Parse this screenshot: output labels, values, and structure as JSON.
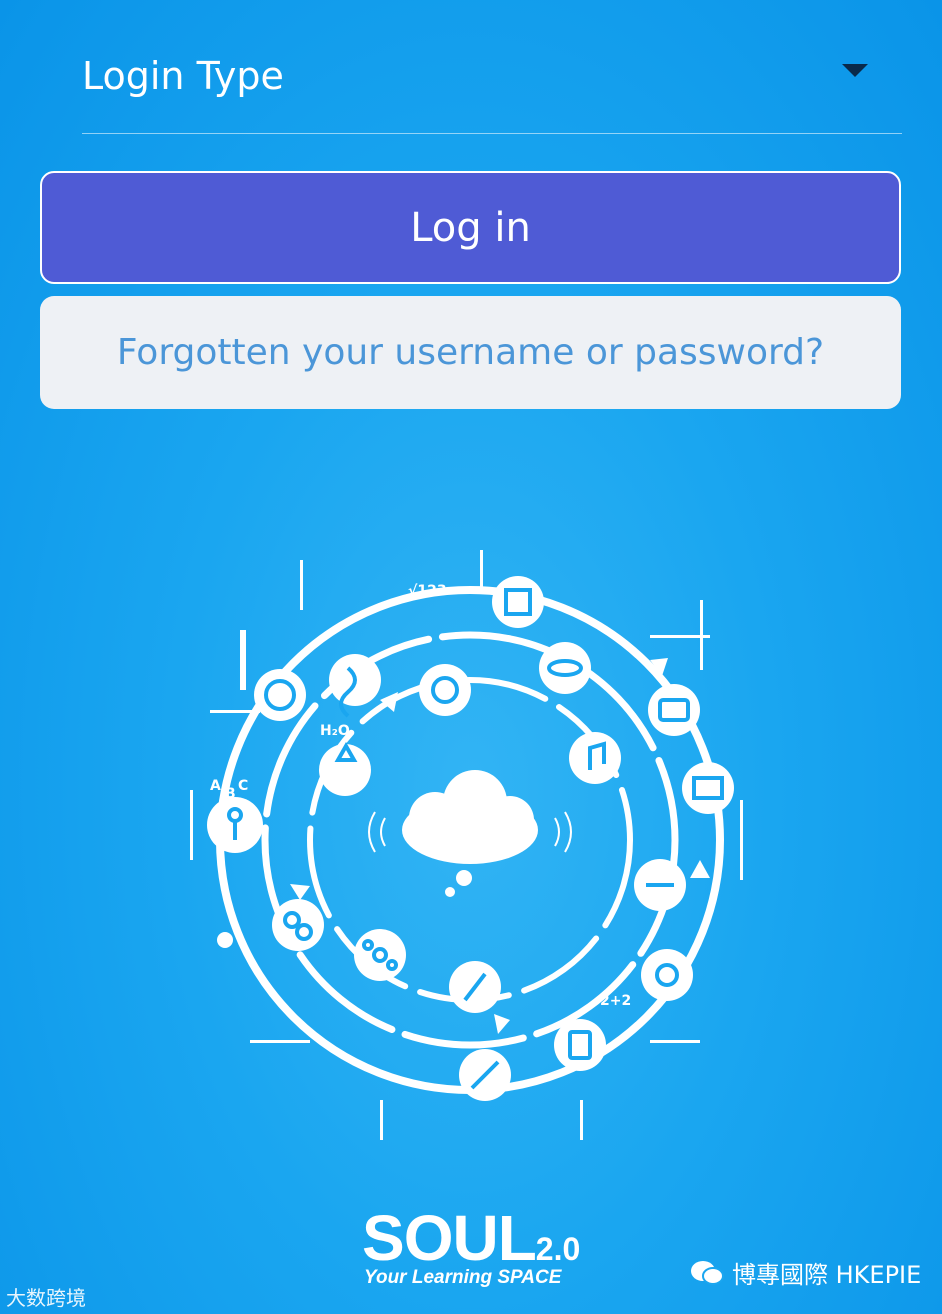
{
  "login_type": {
    "label": "Login Type"
  },
  "buttons": {
    "login_label": "Log in",
    "forgot_label": "Forgotten your username or password?"
  },
  "illustration": {
    "texts": [
      "√123",
      "H₂O",
      "A",
      "B",
      "C",
      "2+2"
    ]
  },
  "brand": {
    "name": "SOUL",
    "version": "2.0",
    "tagline": "Your Learning SPACE"
  },
  "watermarks": {
    "left": "大数跨境",
    "right": "博專國際 HKEPIE"
  },
  "colors": {
    "background": "#1aa6f0",
    "primary_button": "#4f5bd5",
    "secondary_button": "#eef1f5",
    "link_text": "#4b96d8"
  }
}
